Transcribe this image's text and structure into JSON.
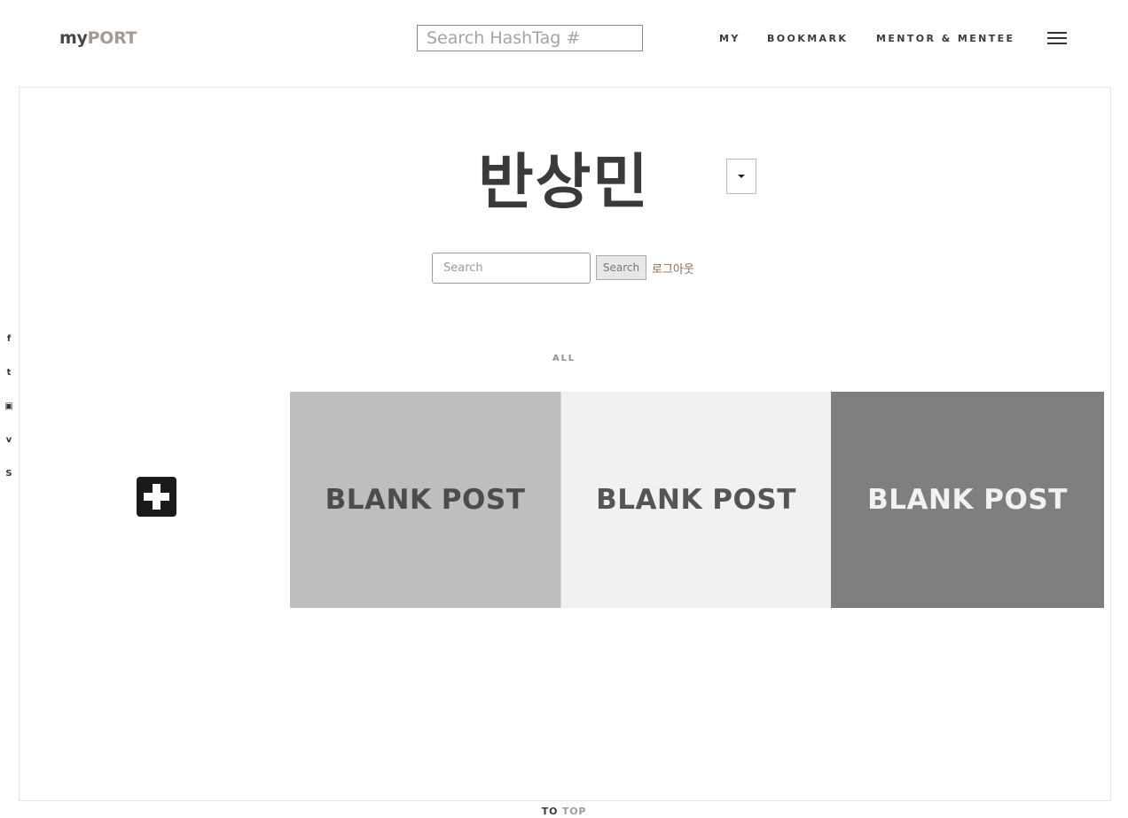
{
  "header": {
    "logo_part1": "my",
    "logo_part2": "PORT",
    "hashtag_search_placeholder": "Search HashTag #",
    "nav": {
      "my": "MY",
      "bookmark": "BOOKMARK",
      "mentor": "MENTOR & MENTEE"
    },
    "menu_icon": "hamburger-menu-icon"
  },
  "profile": {
    "user_name": "반상민",
    "dropdown_icon": "caret-down-icon"
  },
  "search": {
    "placeholder": "Search",
    "button_label": "Search",
    "logout_label": "로그아웃"
  },
  "social": {
    "facebook": "f",
    "twitter": "t",
    "youtube": "▣",
    "vimeo": "v",
    "skype": "S"
  },
  "filter": {
    "all_label": "ALL"
  },
  "posts": [
    {
      "label": "BLANK POST",
      "bg": "#bebebe"
    },
    {
      "label": "BLANK POST",
      "bg": "#f1f1f1"
    },
    {
      "label": "BLANK POST",
      "bg": "#7f7f7f"
    }
  ],
  "add_post_icon": "add-plus-icon",
  "footer": {
    "to": "TO",
    "top": "TOP"
  }
}
